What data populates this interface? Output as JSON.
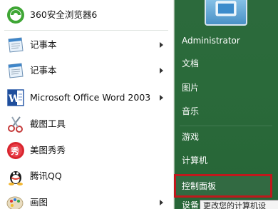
{
  "left_items": [
    {
      "label": "360安全浏览器6",
      "icon": "360-browser-icon"
    },
    {
      "label": "记事本",
      "icon": "notepad-icon"
    },
    {
      "label": "记事本",
      "icon": "notepad-icon"
    },
    {
      "label": "Microsoft Office Word 2003",
      "icon": "word-icon"
    },
    {
      "label": "截图工具",
      "icon": "snipping-tool-icon"
    },
    {
      "label": "美图秀秀",
      "icon": "meitu-icon"
    },
    {
      "label": "腾讯QQ",
      "icon": "qq-icon"
    },
    {
      "label": "画图",
      "icon": "paint-icon"
    }
  ],
  "right_items": [
    {
      "label": "Administrator"
    },
    {
      "label": "文档"
    },
    {
      "label": "图片"
    },
    {
      "label": "音乐"
    },
    {
      "label": "游戏"
    },
    {
      "label": "计算机"
    },
    {
      "label": "控制面板"
    },
    {
      "label": "设备和"
    }
  ],
  "tooltip": "更改您的计算机设",
  "colors": {
    "highlight_border": "#c0181c",
    "right_panel": "#2c6a3c"
  }
}
